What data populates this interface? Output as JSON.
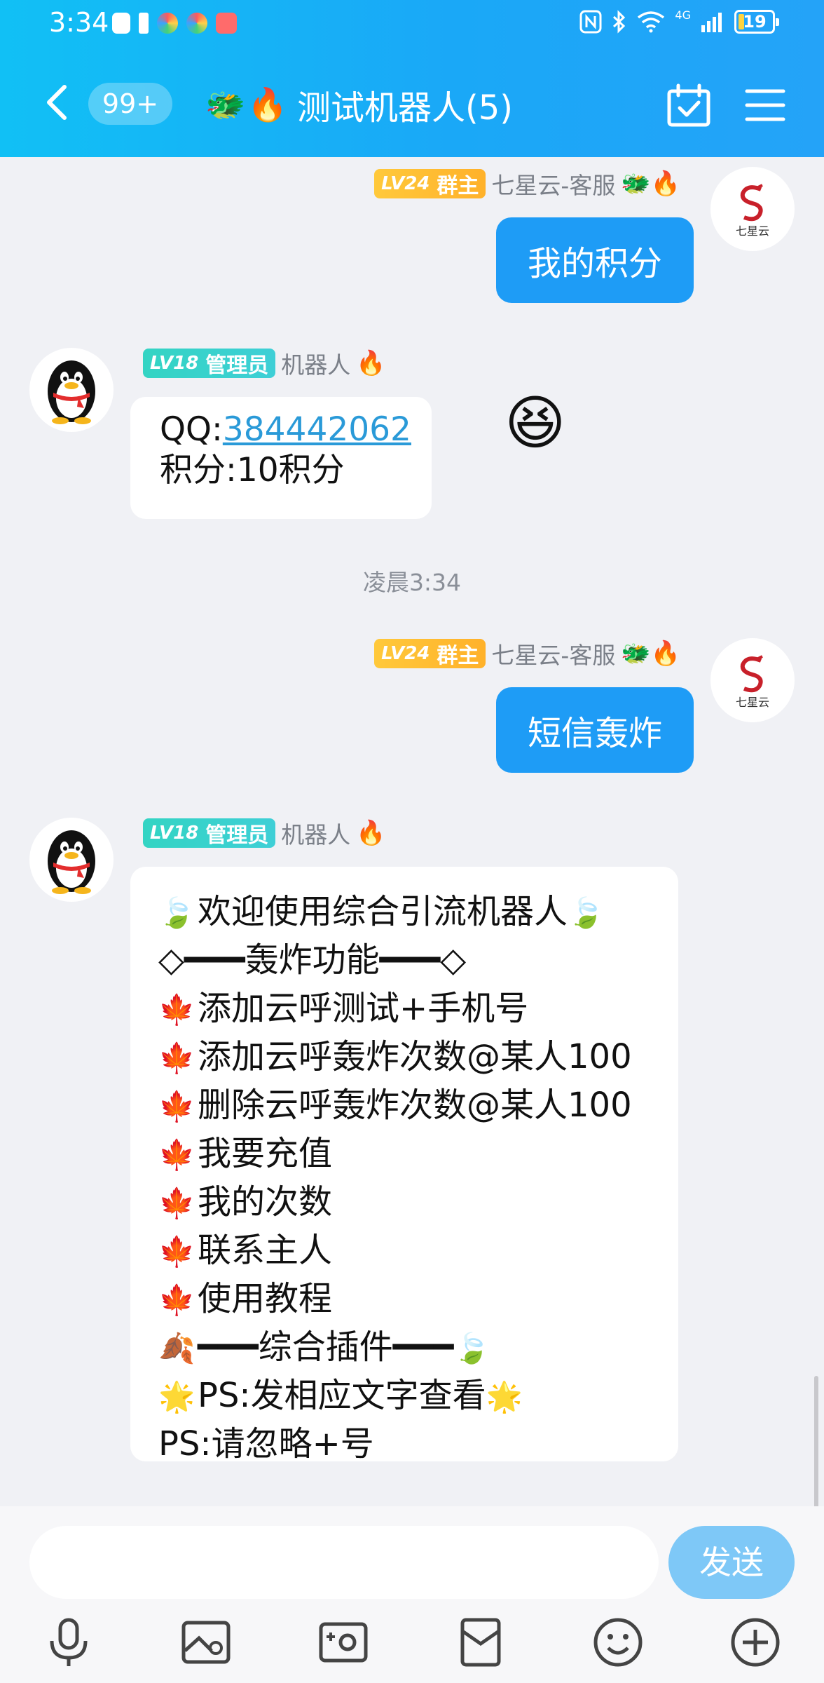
{
  "status_bar": {
    "time": "3:34",
    "network": "4G",
    "battery": "19"
  },
  "nav": {
    "unread_count": "99+",
    "title_emoji_1": "🐲",
    "title_emoji_2": "🔥",
    "title": "测试机器人(5)"
  },
  "messages": [
    {
      "side": "out",
      "level": "LV24",
      "role": "群主",
      "sender": "七星云-客服",
      "sender_emoji": "🐲🔥",
      "text": "我的积分",
      "avatar_label": "七星云"
    },
    {
      "side": "in",
      "level": "LV18",
      "role": "管理员",
      "sender": "机器人",
      "sender_emoji": "🔥",
      "qq_label": "QQ:",
      "qq_number": "384442062",
      "points_line": "积分:10积分"
    },
    {
      "type": "timestamp",
      "text": "凌晨3:34"
    },
    {
      "side": "out",
      "level": "LV24",
      "role": "群主",
      "sender": "七星云-客服",
      "sender_emoji": "🐲🔥",
      "text": "短信轰炸",
      "avatar_label": "七星云"
    },
    {
      "side": "in",
      "level": "LV18",
      "role": "管理员",
      "sender": "机器人",
      "sender_emoji": "🔥",
      "lines": [
        {
          "lead": "🍃",
          "text": "欢迎使用综合引流机器人",
          "trail": "🍃"
        },
        {
          "lead": "",
          "text": "◇━━━轰炸功能━━━◇",
          "trail": ""
        },
        {
          "lead": "🍁",
          "text": "添加云呼测试+手机号",
          "trail": ""
        },
        {
          "lead": "🍁",
          "text": "添加云呼轰炸次数@某人100",
          "trail": ""
        },
        {
          "lead": "🍁",
          "text": "删除云呼轰炸次数@某人100",
          "trail": ""
        },
        {
          "lead": "🍁",
          "text": "我要充值",
          "trail": ""
        },
        {
          "lead": "🍁",
          "text": "我的次数",
          "trail": ""
        },
        {
          "lead": "🍁",
          "text": "联系主人",
          "trail": ""
        },
        {
          "lead": "🍁",
          "text": "使用教程",
          "trail": ""
        },
        {
          "lead": "🍂",
          "text": "━━━综合插件━━━",
          "trail": "🍃"
        },
        {
          "lead": "🌟",
          "text": "PS:发相应文字查看",
          "trail": "🌟"
        },
        {
          "lead": "",
          "text": "PS:请忽略+号",
          "trail": ""
        }
      ]
    }
  ],
  "sticker": "😆",
  "composer": {
    "input_value": "",
    "send_label": "发送"
  },
  "toolbar_icons": [
    "microphone-icon",
    "image-icon",
    "camera-icon",
    "red-packet-icon",
    "emoji-icon",
    "plus-icon"
  ],
  "colors": {
    "header": "#1aa8f7",
    "bubble_out": "#1e9cf6",
    "send_button": "#7ec8f7",
    "owner_badge": "#ffc93b",
    "admin_badge": "#33d4c3"
  }
}
